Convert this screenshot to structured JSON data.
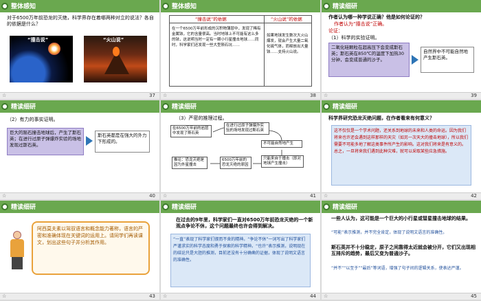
{
  "slides": [
    {
      "num": "37",
      "title": "整体感知",
      "question": "对于6500万年前恐龙的灭绝，科学界存在着哪两种对立的说法？各自的依据是什么？",
      "left_caption": "“撞击说”",
      "right_caption": "“火山说”"
    },
    {
      "num": "38",
      "title": "整体感知",
      "col1_head": "“撞击说”的依据",
      "col2_head": "“火山说”的依据",
      "col1_text": "在一个6500万年前形成的沉积物薄层中，发现了稀有金属铱，它的含量很高。当时地球上不可能有这么多的铱，这说明当时一定有一颗小行星撞击地球……同时，科学家们还发现一些大型陨石坑……",
      "col2_text": "如果地球发生数次大火山爆发，就会产生大量二氧化硫气体，而释放出大量铱……支持火山说。"
    },
    {
      "num": "39",
      "title": "精读细研",
      "q": "作者认为哪一种学说正确？他是如何论证的？",
      "a": "作者认为“撞击说”正确。",
      "label": "论证：",
      "point1": "（1）科学的实验证明。",
      "box": "二氧化硅颗粒在超高压下会变成斯石英；斯石英在850℃的温度下加热30分钟，会变成普通的沙子。",
      "result": "自然界中不可能自然地产生斯石英。"
    },
    {
      "num": "40",
      "title": "精读细研",
      "point2": "（2）有力的事实证明。",
      "box": "巨大的陨石撞击地球后，产生了斯石英；在进行过原子弹爆炸实验的场地发现过斯石英。",
      "result": "斯石英都是在强大的外力下形成的。"
    },
    {
      "num": "41",
      "title": "精读细研",
      "point3": "（3）严密的推理过程。",
      "n1": "在6500万年前的岩层中发现了斯石英",
      "n2": "在进行过原子弹爆炸实验的场地发现过斯石英",
      "n3": "不可能自然地产生",
      "n4": "只能来自于撞击（即对地球产生撞击）",
      "n5": "6500万年前的恐龙灭绝的原因",
      "n6": "推论：恐龙灭绝是因为外星撞击"
    },
    {
      "num": "42",
      "title": "精读细研",
      "q": "科学界研究恐龙灭绝问题，在作者看来有何意义？",
      "body": "这不仅仅是一个学术问题，还关系到地球的未来和人类的命运。因为我们将来也许还会遇到这样那样的天灾（如另一次天大的撞击地球），所以我们需要不可能多地了解这类事件所产生的影响。这对我们将来是有意义的。总之，一旦将来我们遇到此种灾难，就可以采取某些应急措施。"
    },
    {
      "num": "43",
      "title": "精读细研",
      "speech": "阿西莫夫素以驾驭语言和概念能力著称，语言的严密和准确体现在关键词的运用上。请同学们再读课文，划出这些句子并分析其作用。"
    },
    {
      "num": "44",
      "title": "精读细研",
      "sentence": "在过去的9年里，科学家们一直对6500万年前恐龙灭绝的一个新观点争论不休，这个问题最终也许会得到解决。",
      "analysis": "“一直”表现了科学家们锲而不舍的精神。“争论不休”一词写出了科学家们严谨求实的科学态度和勇于探索的科学精神。“也许”表示推测，说明现在的结论只是大胆的推测，目前还没有十分确凿的证据，体现了说明文语言的准确性。"
    },
    {
      "num": "45",
      "title": "精读细研",
      "s1": "一些人认为，这可能是一个巨大的小行星或彗星撞击地球的结果。",
      "a1": "“可能”表示推测，并不完全肯定，体现了说明文语言的准确性。",
      "s2": "斯石英并不十分稳定，原子之间靠得太近就会被分开，它们又出现相互排斥的趋势，最后又变为普通沙子。",
      "a2": "“并不”“以至于”“最后”等词语，增强了句子间的逻辑关系，使表达严谨。"
    }
  ],
  "colors": {
    "topbar": "#6aa84f",
    "purple_box": "#c9c0e6",
    "red_text": "#c00000"
  }
}
